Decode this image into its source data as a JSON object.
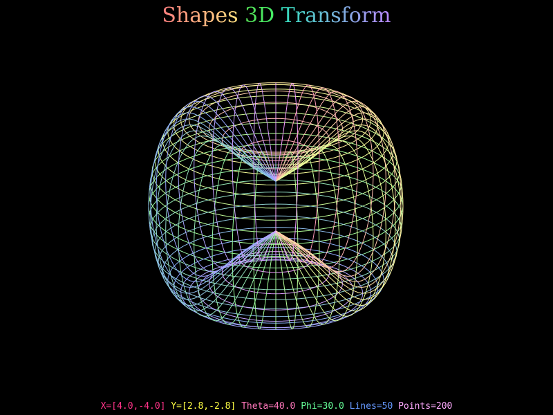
{
  "window": {
    "background": "#000000"
  },
  "title": {
    "words": [
      {
        "text": "Shapes",
        "gradient": [
          "#ff7f7f",
          "#ffdf80"
        ]
      },
      {
        "text": "3D",
        "gradient": [
          "#55dd55",
          "#44ee66"
        ]
      },
      {
        "text": "Transform",
        "gradient": [
          "#33ddbb",
          "#bb88ff"
        ]
      }
    ]
  },
  "shape": {
    "kind": "wireframe-surface",
    "latitude_lines": 30,
    "longitude_lines": 36,
    "palette": [
      "#ff99bb",
      "#ffff99",
      "#99ff99",
      "#88aaff",
      "#ff99ff"
    ]
  },
  "status": {
    "x_range": {
      "text": "X=[4.0,-4.0]",
      "color": "#ff3388"
    },
    "y_range": {
      "text": "Y=[2.8,-2.8]",
      "color": "#ffff44"
    },
    "theta": {
      "text": "Theta=40.0",
      "color": "#ff77bb"
    },
    "phi": {
      "text": "Phi=30.0",
      "color": "#66ff99"
    },
    "lines": {
      "text": "Lines=50",
      "color": "#6699ff"
    },
    "points": {
      "text": "Points=200",
      "color": "#ffaaff"
    }
  }
}
